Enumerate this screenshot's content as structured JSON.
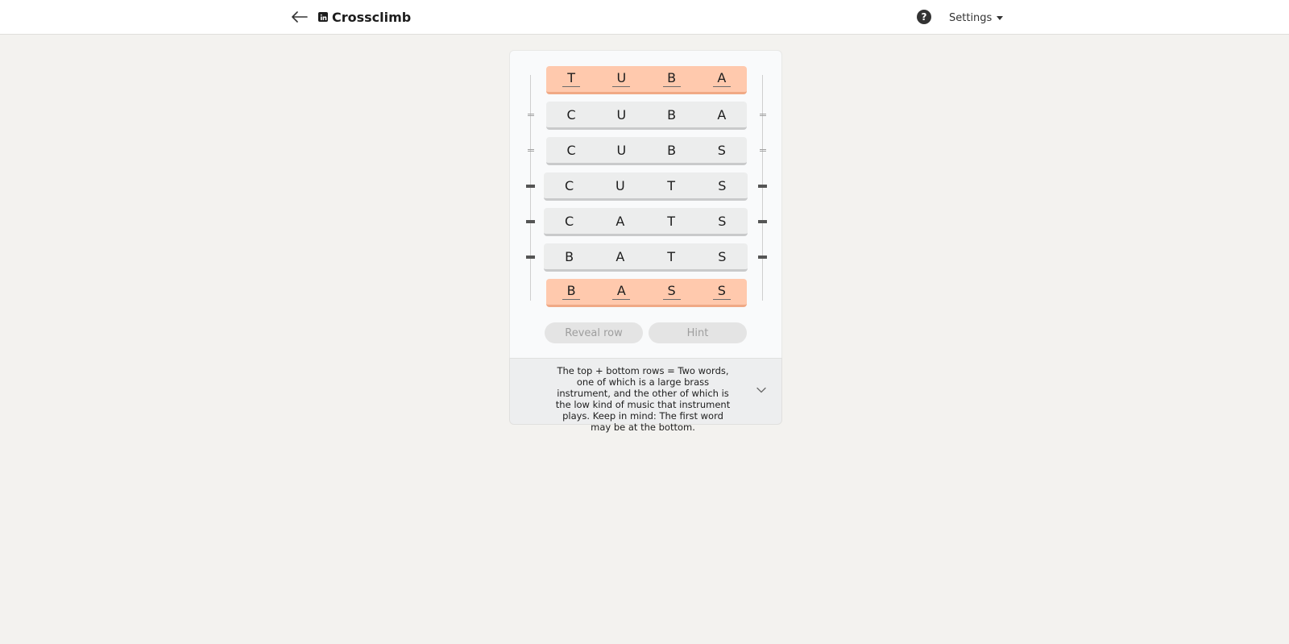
{
  "header": {
    "title": "Crossclimb",
    "settings_label": "Settings",
    "help_label": "?",
    "icons": {
      "back": "arrow-left-icon",
      "logo": "linkedin-icon",
      "help": "question-circle-icon",
      "settings_caret": "caret-down-icon"
    }
  },
  "board": {
    "rows": [
      {
        "letters": [
          "T",
          "U",
          "B",
          "A"
        ],
        "locked": true
      },
      {
        "letters": [
          "C",
          "U",
          "B",
          "A"
        ],
        "locked": false
      },
      {
        "letters": [
          "C",
          "U",
          "B",
          "S"
        ],
        "locked": false
      },
      {
        "letters": [
          "C",
          "U",
          "T",
          "S"
        ],
        "locked": false
      },
      {
        "letters": [
          "C",
          "A",
          "T",
          "S"
        ],
        "locked": false
      },
      {
        "letters": [
          "B",
          "A",
          "T",
          "S"
        ],
        "locked": false
      },
      {
        "letters": [
          "B",
          "A",
          "S",
          "S"
        ],
        "locked": true
      }
    ]
  },
  "actions": {
    "reveal_row": "Reveal row",
    "hint": "Hint"
  },
  "clue": {
    "text": "The top + bottom rows = Two words, one of which is a large brass instrument, and the other of which is the low kind of music that instrument plays. Keep in mind: The first word may be at the bottom."
  },
  "colors": {
    "locked_row": "#ffc9ad",
    "plain_row": "#eceded",
    "background": "#f3f2ef"
  }
}
